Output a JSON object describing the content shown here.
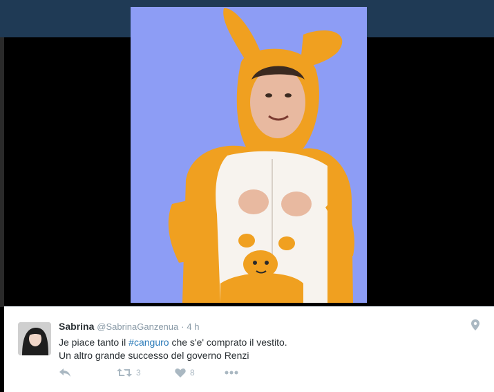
{
  "tweet": {
    "author_name": "Sabrina",
    "author_handle": "@SabrinaGanzenua",
    "separator": "·",
    "time": "4 h",
    "text_line1_prefix": "Je piace tanto il ",
    "hashtag": "#canguro",
    "text_line1_suffix": " che s'e' comprato il vestito.",
    "text_line2": "Un altro grande successo del governo Renzi",
    "retweet_count": "3",
    "like_count": "8"
  },
  "icons": {
    "reply": "reply-icon",
    "retweet": "retweet-icon",
    "like": "heart-icon",
    "more": "more-icon",
    "location": "location-pin-icon"
  },
  "colors": {
    "photo_background": "#8d9df5",
    "costume_orange": "#f0a020",
    "hashtag_link": "#2b7bb9",
    "action_gray": "#aab8c2",
    "top_bar": "#1f3a55"
  }
}
